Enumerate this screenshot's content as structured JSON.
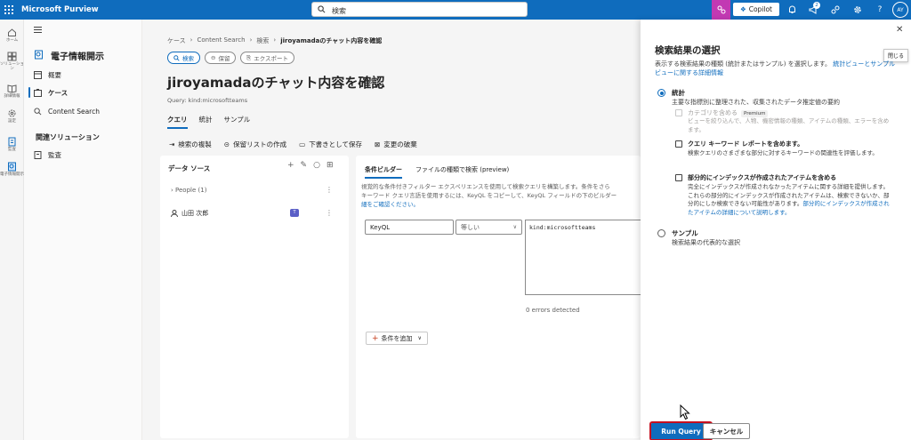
{
  "topbar": {
    "app_title": "Microsoft Purview",
    "search_placeholder": "検索",
    "copilot_label": "Copilot",
    "notification_count": "2",
    "avatar_initials": "AY",
    "help_label": "?"
  },
  "rail": [
    {
      "label": "ホーム",
      "icon": "home-icon"
    },
    {
      "label": "ソリューション",
      "icon": "solutions-icon"
    },
    {
      "label": "詳細情報",
      "icon": "learn-icon"
    },
    {
      "label": "設定",
      "icon": "settings-icon"
    },
    {
      "label": "監査",
      "icon": "audit-icon"
    },
    {
      "label": "電子情報開示",
      "icon": "ediscovery-icon"
    }
  ],
  "nav": {
    "heading": "電子情報開示",
    "items": [
      {
        "label": "概要",
        "icon": "overview-icon"
      },
      {
        "label": "ケース",
        "icon": "case-icon"
      },
      {
        "label": "Content Search",
        "icon": "search-icon"
      }
    ],
    "section": "関連ソリューション",
    "related": [
      {
        "label": "監査",
        "icon": "audit-icon"
      }
    ]
  },
  "main": {
    "breadcrumb": [
      "ケース",
      "Content Search",
      "検索",
      "jiroyamadaのチャット内容を確認"
    ],
    "chips": [
      "検索",
      "保留",
      "エクスポート"
    ],
    "title": "jiroyamadaのチャット内容を確認",
    "query": "Query: kind:microsoftteams",
    "tabs": [
      "クエリ",
      "統計",
      "サンプル"
    ],
    "toolbar": [
      "検索の複製",
      "保留リストの作成",
      "下書きとして保存",
      "変更の破棄"
    ]
  },
  "data_sources": {
    "title": "データ ソース",
    "people_group": "People (1)",
    "user": "山田 次郎",
    "more": "⋮"
  },
  "condition": {
    "tabs": [
      "条件ビルダー",
      "ファイルの種類で検索 (preview)"
    ],
    "desc_line1": "視覚的な条件付きフィルター エクスペリエンスを使用して検索クエリを構築します。条件をさら",
    "desc_line2": "キーワード クエリ言語を使用するには、KeyQL をコピーして、KeyQL フィールドの下のビルダー",
    "desc_line3": "細をご確認ください。",
    "field": "KeyQL",
    "operator": "等しい",
    "value": "kind:microsoftteams",
    "errors": "0 errors detected",
    "add_label": "条件を追加"
  },
  "panel": {
    "close_tip": "閉じる",
    "title": "検索結果の選択",
    "desc": "表示する検索結果の種類 (統計またはサンプル) を選択します。",
    "desc_link": "統計ビューとサンプル ビューに関する詳細情報",
    "opt_stats": {
      "label": "統計",
      "desc": "主要な指標別に整理された、収集されたデータ推定値の要約"
    },
    "cb_category": {
      "label": "カテゴリを含める",
      "badge": "Premium",
      "desc": "ビューを絞り込んで、人物、機密情報の種類、アイテムの種類、エラーを含めます。"
    },
    "cb_keyword": {
      "label": "クエリ キーワード レポートを含めます。",
      "desc": "検索クエリのさまざまな部分に対するキーワードの関連性を評価します。"
    },
    "cb_partial": {
      "label": "部分的にインデックスが作成されたアイテムを含める",
      "desc": "完全にインデックスが作成されなかったアイテムに関する詳細を提供します。これらの部分的にインデックスが作成されたアイテムは、検索できないか、部分的にしか検索できない可能性があります。",
      "link": "部分的にインデックスが作成されたアイテムの詳細について説明します。"
    },
    "opt_sample": {
      "label": "サンプル",
      "desc": "検索結果の代表的な選択"
    },
    "run_label": "Run Query",
    "cancel_label": "キャンセル"
  }
}
